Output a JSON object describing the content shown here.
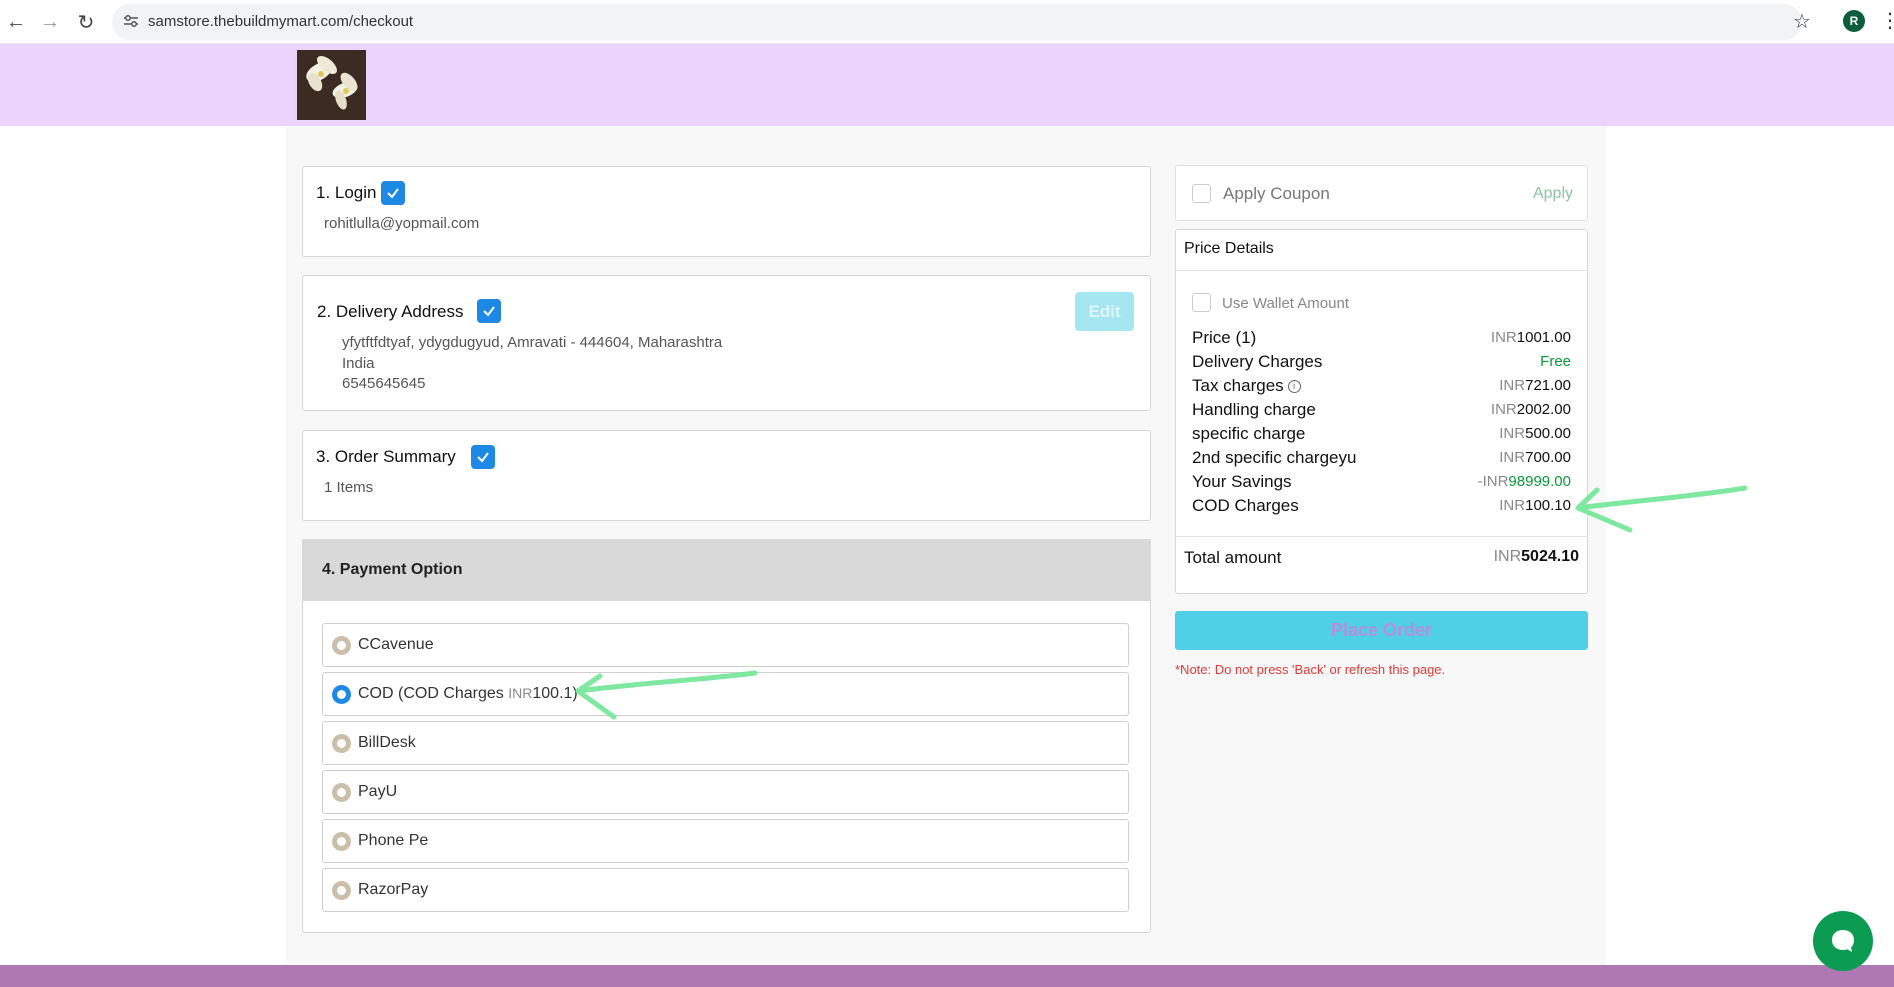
{
  "browser": {
    "url": "samstore.thebuildmymart.com/checkout",
    "profile_initial": "R"
  },
  "steps": {
    "login": {
      "title": "1. Login",
      "email": "rohitlulla@yopmail.com"
    },
    "address": {
      "title": "2. Delivery Address",
      "line1": "yfytftfdtyaf, ydygdugyud, Amravati - 444604, Maharashtra",
      "line2": "India",
      "line3": "6545645645",
      "edit_label": "Edit"
    },
    "summary": {
      "title": "3. Order Summary",
      "items": "1 Items"
    },
    "payment": {
      "title": "4. Payment Option",
      "options": [
        {
          "label": "CCavenue"
        },
        {
          "label": "COD (COD Charges ",
          "currency": "INR",
          "amount": "100.1",
          "suffix": ")",
          "selected": true
        },
        {
          "label": "BillDesk"
        },
        {
          "label": "PayU"
        },
        {
          "label": "Phone Pe"
        },
        {
          "label": "RazorPay"
        }
      ]
    }
  },
  "coupon": {
    "label": "Apply Coupon",
    "apply": "Apply"
  },
  "price_details": {
    "title": "Price Details",
    "wallet_label": "Use Wallet Amount",
    "rows": [
      {
        "label": "Price (1)",
        "prefix": "",
        "currency": "INR",
        "value": "1001.00"
      },
      {
        "label": "Delivery Charges",
        "prefix": "",
        "currency": "",
        "value": "Free"
      },
      {
        "label": "Tax charges",
        "prefix": "",
        "currency": "INR",
        "value": "721.00"
      },
      {
        "label": "Handling charge",
        "prefix": "",
        "currency": "INR",
        "value": "2002.00"
      },
      {
        "label": "specific charge",
        "prefix": "",
        "currency": "INR",
        "value": "500.00"
      },
      {
        "label": "2nd specific chargeyu",
        "prefix": "",
        "currency": "INR",
        "value": "700.00"
      },
      {
        "label": "Your Savings",
        "prefix": "-",
        "currency": "INR",
        "value": "98999.00"
      },
      {
        "label": "COD Charges",
        "prefix": "",
        "currency": "INR",
        "value": "100.10"
      }
    ],
    "total_label": "Total amount",
    "total_currency": "INR",
    "total_value": "5024.10"
  },
  "place_order": "Place Order",
  "note": "*Note: Do not press 'Back' or refresh this page.",
  "colors": {
    "header_bg": "#ecd3fb",
    "accent_blue": "#1e88e5",
    "place_order_bg": "#4fd0e6",
    "savings_green": "#0a9a3a",
    "footer": "#ae78b2",
    "annotation_arrow": "#7ee8a0"
  }
}
